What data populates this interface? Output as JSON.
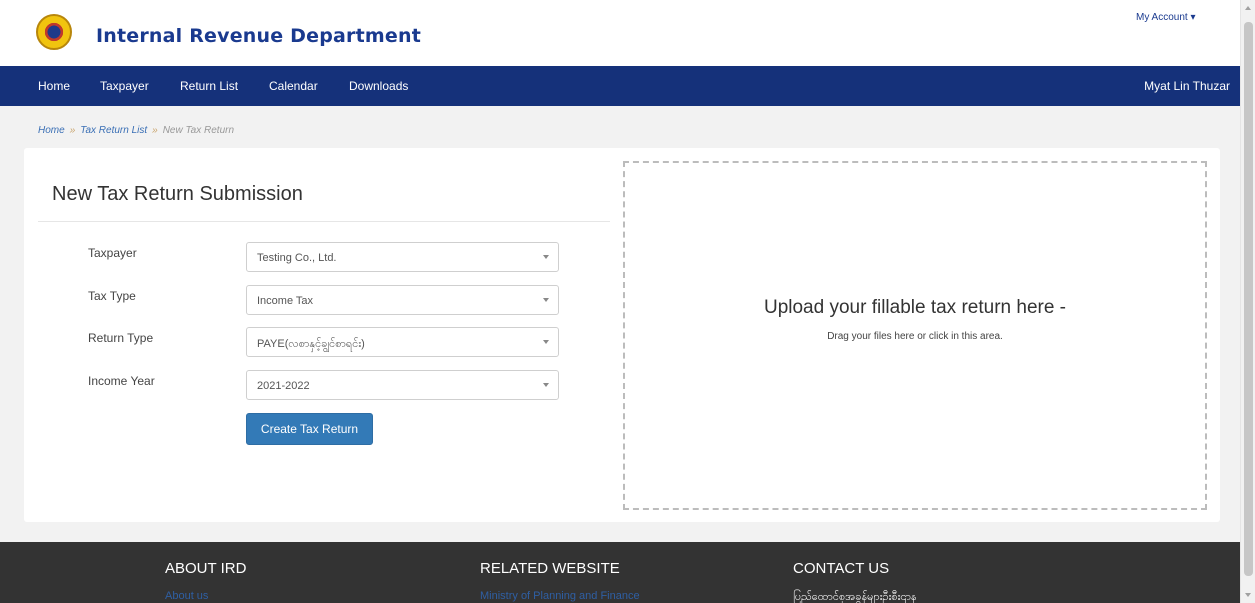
{
  "header": {
    "logo_icon": "ird-seal-logo",
    "brand": "Internal Revenue Department",
    "my_account": "My Account ▾"
  },
  "nav": {
    "items": [
      "Home",
      "Taxpayer",
      "Return List",
      "Calendar",
      "Downloads"
    ],
    "user": "Myat Lin Thuzar"
  },
  "breadcrumb": {
    "home": "Home",
    "list": "Tax Return List",
    "current": "New Tax Return",
    "separator": "»"
  },
  "form": {
    "title": "New Tax Return Submission",
    "fields": [
      {
        "label": "Taxpayer",
        "value": "Testing Co., Ltd."
      },
      {
        "label": "Tax Type",
        "value": "Income Tax"
      },
      {
        "label": "Return Type",
        "value": "PAYE(လစာနှင့်ချွင်စာရင်း)"
      },
      {
        "label": "Income Year",
        "value": "2021-2022"
      }
    ],
    "submit_label": "Create Tax Return"
  },
  "dropzone": {
    "title": "Upload your fillable tax return here -",
    "subtitle": "Drag your files here or click in this area."
  },
  "footer": {
    "about": {
      "heading": "ABOUT IRD",
      "link": "About us"
    },
    "related": {
      "heading": "RELATED WEBSITE",
      "link": "Ministry of Planning and Finance"
    },
    "contact": {
      "heading": "CONTACT US",
      "text": "ပြည်ထောင်စုအခွန်များဦးစီးဌာန"
    }
  },
  "colors": {
    "brand": "#1a3a8f",
    "navbar": "#15317a",
    "button": "#337ab7",
    "footer": "#333333"
  }
}
